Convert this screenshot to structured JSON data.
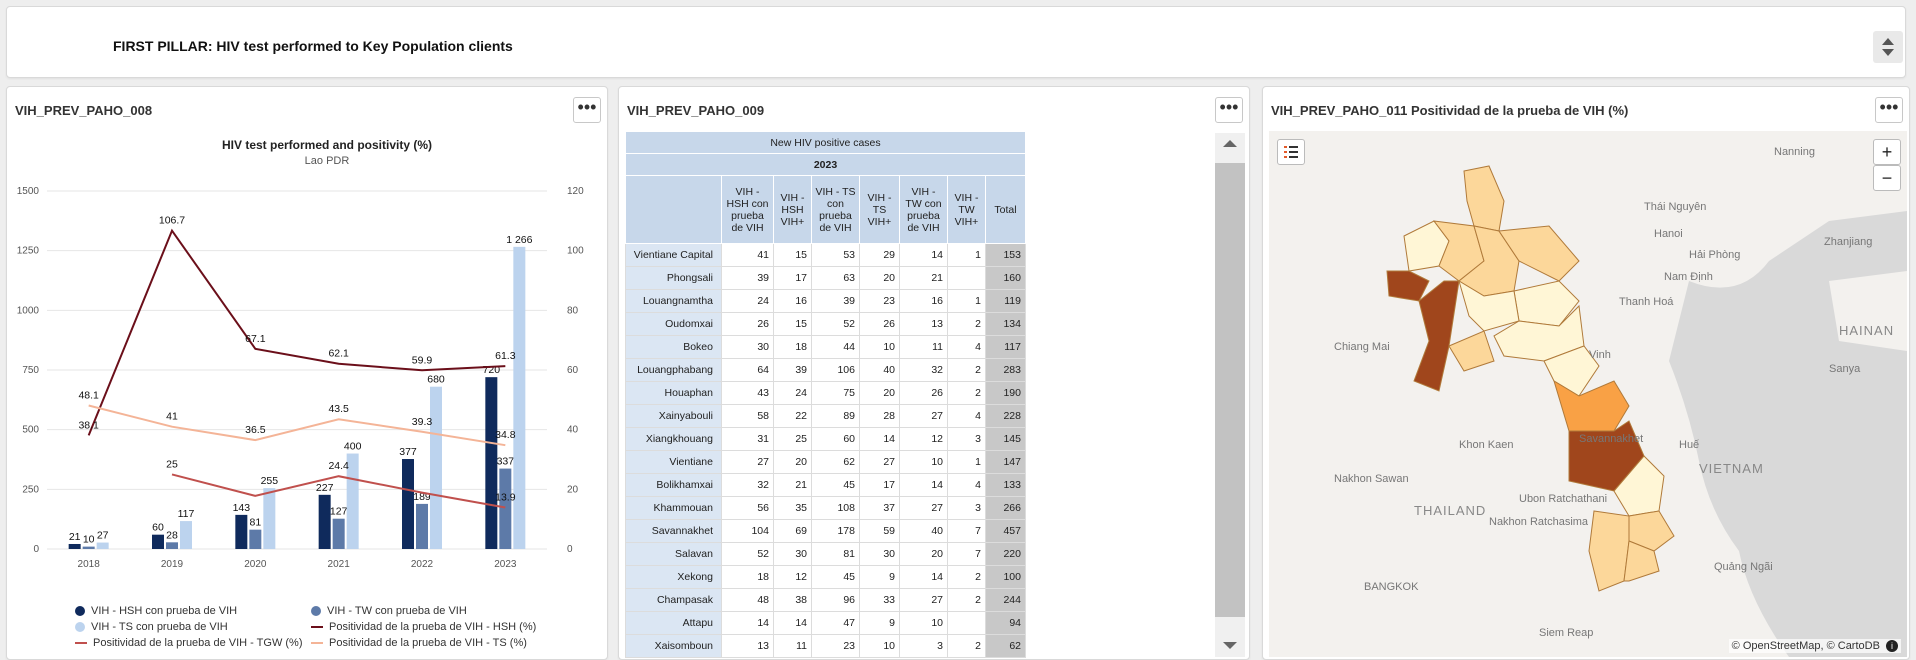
{
  "header": {
    "title": "FIRST PILLAR: HIV test performed to Key Population clients"
  },
  "panels": {
    "chart_panel_title": "VIH_PREV_PAHO_008",
    "table_panel_title": "VIH_PREV_PAHO_009",
    "map_panel_title": "VIH_PREV_PAHO_011 Positividad de la prueba de VIH (%)",
    "menu_glyph": "•••"
  },
  "chart_data": {
    "type": "bar",
    "title": "HIV test performed and positivity (%)",
    "subtitle": "Lao PDR",
    "categories": [
      "2018",
      "2019",
      "2020",
      "2021",
      "2022",
      "2023"
    ],
    "ylim": [
      0,
      1500
    ],
    "y2lim": [
      0,
      120
    ],
    "yticks": [
      "0",
      "250",
      "500",
      "750",
      "1000",
      "1250",
      "1500"
    ],
    "y2ticks": [
      "0",
      "20",
      "40",
      "60",
      "80",
      "100",
      "120"
    ],
    "bar_series": [
      {
        "name": "VIH - HSH con prueba de VIH",
        "color": "#0f2a5c",
        "values": [
          21,
          60,
          143,
          227,
          377,
          720
        ]
      },
      {
        "name": "VIH - TW con prueba de VIH",
        "color": "#5d7aa8",
        "values": [
          10,
          28,
          81,
          127,
          189,
          337
        ]
      },
      {
        "name": "VIH - TS con prueba de VIH",
        "color": "#bcd3ee",
        "values": [
          27,
          117,
          255,
          400,
          680,
          1266
        ]
      }
    ],
    "bar_labels": [
      [
        "21",
        "60",
        "143",
        "227",
        "377",
        "720"
      ],
      [
        "10",
        "28",
        "81",
        "127",
        "189",
        "337"
      ],
      [
        "27",
        "117",
        "255",
        "400",
        "680",
        "1 266"
      ]
    ],
    "line_series": [
      {
        "name": "Positividad de la prueba de VIH - HSH (%)",
        "color": "#6b0f1a",
        "values": [
          38.1,
          106.7,
          67.1,
          62.1,
          59.9,
          61.3
        ]
      },
      {
        "name": "Positividad de la prueba de VIH - TGW (%)",
        "color": "#c0504d",
        "values": [
          null,
          25,
          17.8,
          24.4,
          18.9,
          13.9
        ]
      },
      {
        "name": "Positividad de la prueba de VIH - TS (%)",
        "color": "#f4b497",
        "values": [
          48.1,
          41,
          36.5,
          43.5,
          39.3,
          34.8
        ]
      }
    ],
    "line_labels": [
      [
        "38.1",
        "106.7",
        "67.1",
        "62.1",
        "59.9",
        "61.3"
      ],
      [
        "",
        "25",
        "",
        "24.4",
        "",
        "13.9"
      ],
      [
        "48.1",
        "41",
        "36.5",
        "43.5",
        "39.3",
        "34.8"
      ]
    ]
  },
  "table": {
    "title": "New HIV positive cases",
    "year": "2023",
    "columns": [
      "VIH - HSH con prueba de VIH",
      "VIH - HSH VIH+",
      "VIH - TS con prueba de VIH",
      "VIH - TS VIH+",
      "VIH - TW con prueba de VIH",
      "VIH - TW VIH+",
      "Total"
    ],
    "rows": [
      {
        "name": "Vientiane Capital",
        "v": [
          "41",
          "15",
          "53",
          "29",
          "14",
          "1",
          "153"
        ]
      },
      {
        "name": "Phongsali",
        "v": [
          "39",
          "17",
          "63",
          "20",
          "21",
          "",
          "160"
        ]
      },
      {
        "name": "Louangnamtha",
        "v": [
          "24",
          "16",
          "39",
          "23",
          "16",
          "1",
          "119"
        ]
      },
      {
        "name": "Oudomxai",
        "v": [
          "26",
          "15",
          "52",
          "26",
          "13",
          "2",
          "134"
        ]
      },
      {
        "name": "Bokeo",
        "v": [
          "30",
          "18",
          "44",
          "10",
          "11",
          "4",
          "117"
        ]
      },
      {
        "name": "Louangphabang",
        "v": [
          "64",
          "39",
          "106",
          "40",
          "32",
          "2",
          "283"
        ]
      },
      {
        "name": "Houaphan",
        "v": [
          "43",
          "24",
          "75",
          "20",
          "26",
          "2",
          "190"
        ]
      },
      {
        "name": "Xainyabouli",
        "v": [
          "58",
          "22",
          "89",
          "28",
          "27",
          "4",
          "228"
        ]
      },
      {
        "name": "Xiangkhouang",
        "v": [
          "31",
          "25",
          "60",
          "14",
          "12",
          "3",
          "145"
        ]
      },
      {
        "name": "Vientiane",
        "v": [
          "27",
          "20",
          "62",
          "27",
          "10",
          "1",
          "147"
        ]
      },
      {
        "name": "Bolikhamxai",
        "v": [
          "32",
          "21",
          "45",
          "17",
          "14",
          "4",
          "133"
        ]
      },
      {
        "name": "Khammouan",
        "v": [
          "56",
          "35",
          "108",
          "37",
          "27",
          "3",
          "266"
        ]
      },
      {
        "name": "Savannakhet",
        "v": [
          "104",
          "69",
          "178",
          "59",
          "40",
          "7",
          "457"
        ]
      },
      {
        "name": "Salavan",
        "v": [
          "52",
          "30",
          "81",
          "30",
          "20",
          "7",
          "220"
        ]
      },
      {
        "name": "Xekong",
        "v": [
          "18",
          "12",
          "45",
          "9",
          "14",
          "2",
          "100"
        ]
      },
      {
        "name": "Champasak",
        "v": [
          "48",
          "38",
          "96",
          "33",
          "27",
          "2",
          "244"
        ]
      },
      {
        "name": "Attapu",
        "v": [
          "14",
          "14",
          "47",
          "9",
          "10",
          "",
          "94"
        ]
      },
      {
        "name": "Xaisomboun",
        "v": [
          "13",
          "11",
          "23",
          "10",
          "3",
          "2",
          "62"
        ]
      }
    ]
  },
  "map": {
    "zoom_in": "+",
    "zoom_out": "−",
    "attribution": "© OpenStreetMap, © CartoDB",
    "places": [
      "Nanning",
      "Thái Nguyên",
      "Hanoi",
      "Hải Phòng",
      "Nam Định",
      "Zhanjiang",
      "Thanh Hoá",
      "HAINAN",
      "Chiang Mai",
      "Vinh",
      "Sanya",
      "Savannakhet",
      "Khon Kaen",
      "Huế",
      "VIETNAM",
      "Nakhon Sawan",
      "THAILAND",
      "Ubon Ratchathani",
      "Nakhon Ratchasima",
      "BANGKOK",
      "Siem Reap",
      "Quảng Ngãi"
    ],
    "colors": {
      "light": "#fff6d6",
      "mid": "#fcd79a",
      "orange": "#f9a145",
      "dark": "#a0461c"
    }
  }
}
